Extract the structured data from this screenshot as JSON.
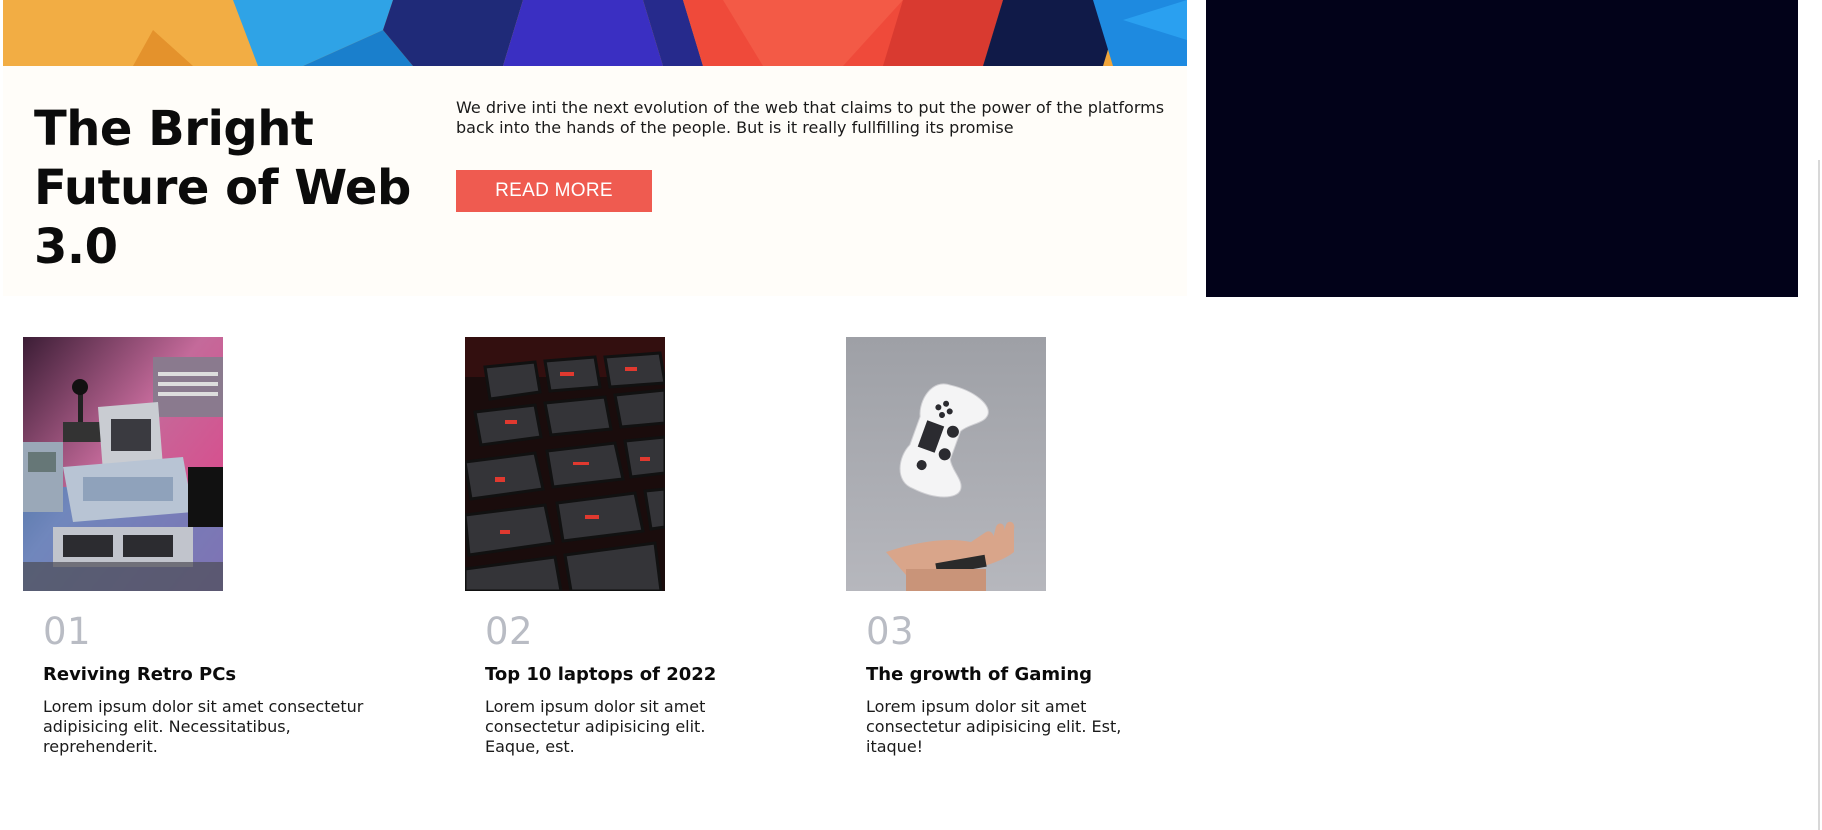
{
  "hero": {
    "title": "The Bright Future of Web 3.0",
    "description": "We drive inti the next evolution of the web that claims to put the power of the platforms back into the hands of the people. But is it really fullfilling its promise",
    "read_more_label": "READ MORE",
    "image_icon": "abstract-blocks-image"
  },
  "articles": [
    {
      "number": "01",
      "title": "Reviving Retro PCs",
      "text": "Lorem ipsum dolor sit amet consectetur adipisicing elit. Necessitatibus, reprehenderit.",
      "image_icon": "retro-pc-image"
    },
    {
      "number": "02",
      "title": "Top 10 laptops of 2022",
      "text": "Lorem ipsum dolor sit amet consectetur adipisicing elit. Eaque, est.",
      "image_icon": "keyboard-image"
    },
    {
      "number": "03",
      "title": "The growth of Gaming",
      "text": "Lorem ipsum dolor sit amet consectetur adipisicing elit. Est, itaque!",
      "image_icon": "game-controller-image"
    }
  ],
  "colors": {
    "accent": "#ef5b50",
    "dark_panel": "#020219",
    "hero_panel_bg": "#fffdf9",
    "number_gray": "#b9bcc4"
  }
}
